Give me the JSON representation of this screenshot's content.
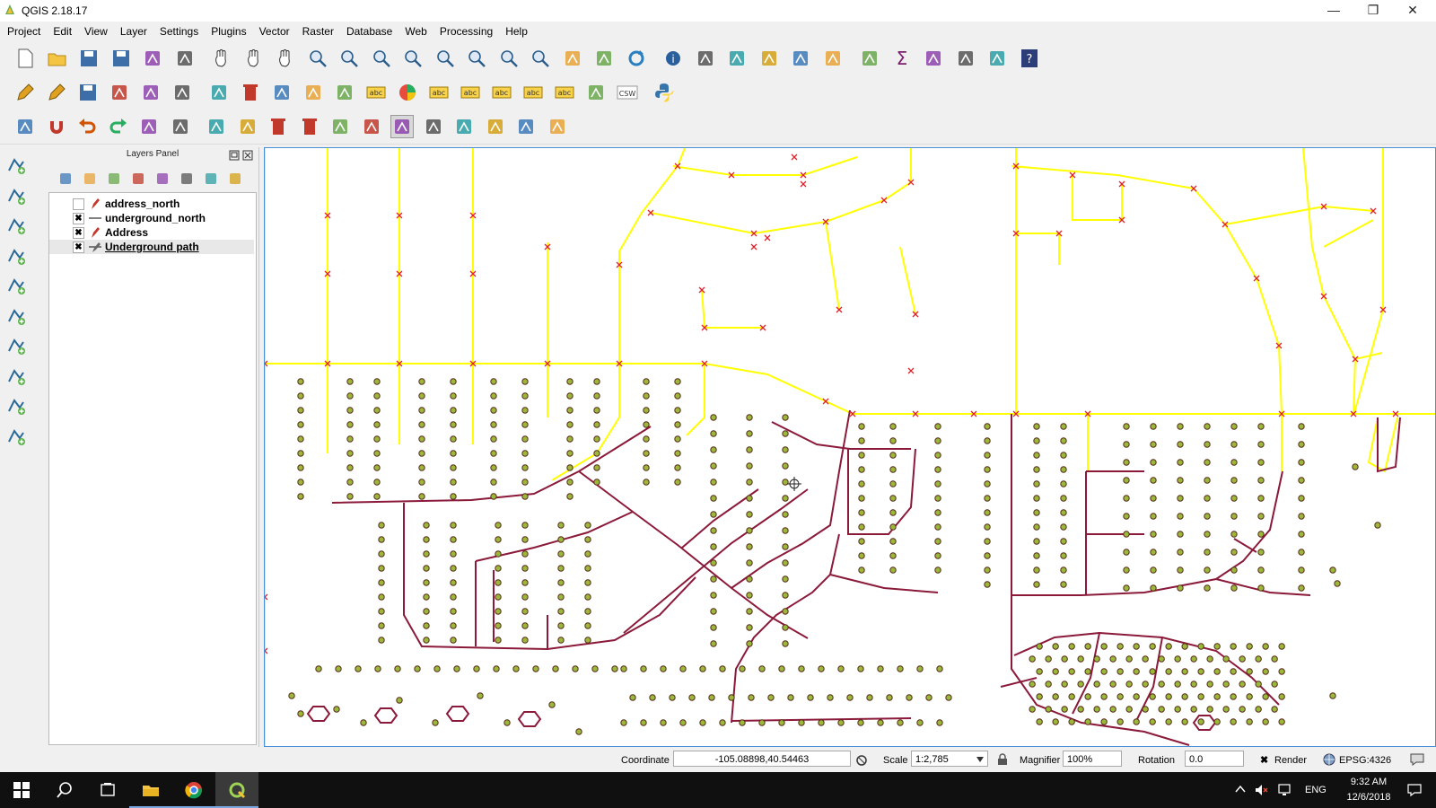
{
  "window": {
    "title": "QGIS 2.18.17",
    "minimize_glyph": "—",
    "restore_glyph": "❐",
    "close_glyph": "✕"
  },
  "menus": [
    "Project",
    "Edit",
    "View",
    "Layer",
    "Settings",
    "Plugins",
    "Vector",
    "Raster",
    "Database",
    "Web",
    "Processing",
    "Help"
  ],
  "toolbars": {
    "row1_icons": [
      "new-project-icon",
      "open-project-icon",
      "save-project-icon",
      "save-as-icon",
      "new-print-composer-icon",
      "composer-manager-icon",
      "pan-to-selection-icon",
      "pan-icon",
      "pan-map-icon",
      "zoom-in-icon",
      "zoom-out-icon",
      "zoom-native-icon",
      "zoom-full-icon",
      "zoom-to-selection-icon",
      "zoom-to-layer-icon",
      "zoom-last-icon",
      "zoom-next-icon",
      "new-bookmark-icon",
      "show-bookmarks-icon",
      "refresh-icon",
      "identify-icon",
      "run-action-icon",
      "select-features-icon",
      "select-by-value-icon",
      "deselect-icon",
      "attribute-table-icon",
      "field-calculator-icon",
      "statistics-icon",
      "measure-icon",
      "map-tips-icon",
      "text-annotation-icon",
      "help-icon"
    ],
    "row2_icons": [
      "current-edits-icon",
      "toggle-editing-icon",
      "save-edits-icon",
      "digitize-icon",
      "add-feature-icon",
      "vertex-tool-icon",
      "move-feature-icon",
      "delete-selected-icon",
      "cut-features-icon",
      "copy-features-icon",
      "paste-features-icon",
      "label-icon",
      "diagram-icon",
      "highlight-labels-icon",
      "pin-labels-icon",
      "show-hide-labels-icon",
      "move-label-icon",
      "rotate-label-icon",
      "change-label-icon",
      "csw-icon",
      "python-icon"
    ],
    "row3_icons": [
      "snapping-icon",
      "magnet-icon",
      "undo-icon",
      "redo-icon",
      "simplify-icon",
      "add-ring-icon",
      "add-part-icon",
      "fill-ring-icon",
      "delete-ring-icon",
      "delete-part-icon",
      "reshape-icon",
      "offset-curve-icon",
      "split-features-icon",
      "split-parts-icon",
      "merge-features-icon",
      "merge-attributes-icon",
      "rotate-symbols-icon",
      "rotate-feature-icon"
    ],
    "csw_label": "CSW",
    "label_abc": "abc"
  },
  "layers_panel": {
    "title": "Layers Panel",
    "layers": [
      {
        "name": "address_north",
        "checked": false,
        "mark": "",
        "symbol": "pencil-icon"
      },
      {
        "name": "underground_north",
        "checked": true,
        "mark": "✖",
        "symbol": "line-icon"
      },
      {
        "name": "Address",
        "checked": true,
        "mark": "✖",
        "symbol": "pencil-icon"
      },
      {
        "name": "Underground path",
        "checked": true,
        "mark": "✖",
        "symbol": "line-edit-icon"
      }
    ]
  },
  "map": {
    "colors": {
      "underground": "#ffff00",
      "underground_vertex": "#e0202a",
      "path": "#8b1a3a",
      "address_fill": "#9ab83a",
      "address_stroke": "#5a2a1a"
    },
    "cursor_icon": "crosshair-icon"
  },
  "statusbar": {
    "coordinate_label": "Coordinate",
    "coordinate_value": "-105.08898,40.54463",
    "scale_label": "Scale",
    "scale_value": "1:2,785",
    "magnifier_label": "Magnifier",
    "magnifier_value": "100%",
    "rotation_label": "Rotation",
    "rotation_value": "0.0",
    "render_label": "Render",
    "crs_label": "EPSG:4326"
  },
  "taskbar": {
    "language": "ENG",
    "time": "9:32 AM",
    "date": "12/6/2018"
  }
}
